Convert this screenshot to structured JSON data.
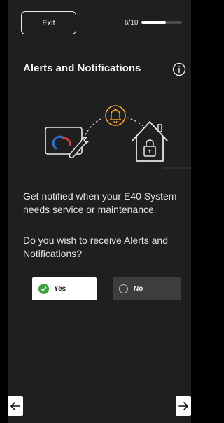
{
  "header": {
    "exit_label": "Exit",
    "step_counter": "6/10",
    "progress_fraction": 0.6
  },
  "title": "Alerts and Notifications",
  "description": "Get notified when your E40 System needs service or maintenance.",
  "question": "Do you wish to receive Alerts and Notifications?",
  "options": [
    {
      "label": "Yes",
      "selected": true
    },
    {
      "label": "No",
      "selected": false
    }
  ],
  "icons": {
    "info": "info-icon",
    "illustration": [
      "thermostat-wrench-icon",
      "bell-icon",
      "house-lock-icon"
    ],
    "back": "arrow-left-icon",
    "next": "arrow-right-icon"
  },
  "colors": {
    "background": "#1f1f1f",
    "accent_orange": "#f5a623",
    "check_green": "#3aa43a",
    "dial_red": "#e53935",
    "dial_blue": "#2f6fd6"
  }
}
